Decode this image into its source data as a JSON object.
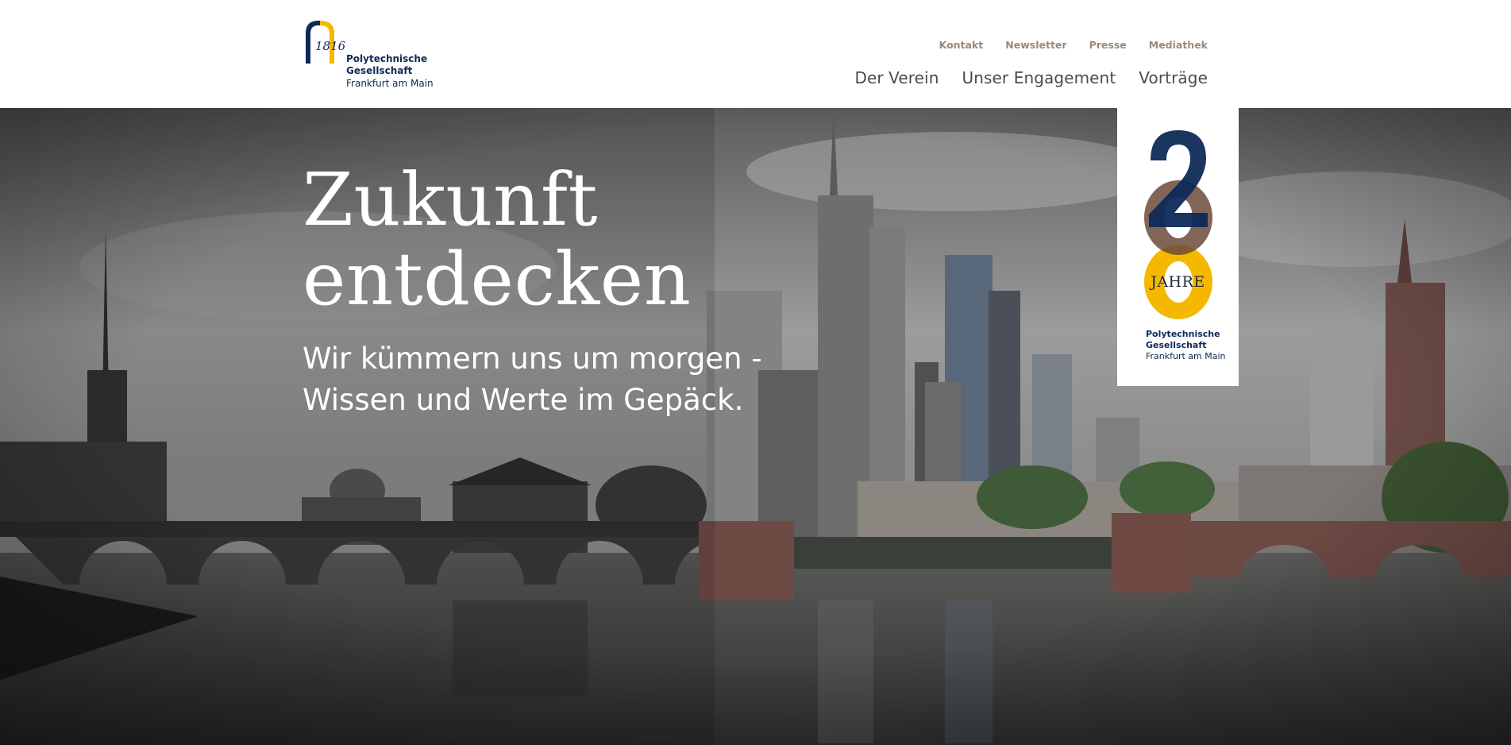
{
  "logo": {
    "year": "1816",
    "line1": "Polytechnische",
    "line2": "Gesellschaft",
    "line3": "Frankfurt am Main",
    "colors": {
      "navy": "#0d2a57",
      "gold": "#f5b800"
    }
  },
  "meta_nav": {
    "items": [
      {
        "label": "Kontakt"
      },
      {
        "label": "Newsletter"
      },
      {
        "label": "Presse"
      },
      {
        "label": "Mediathek"
      }
    ]
  },
  "main_nav": {
    "items": [
      {
        "label": "Der Verein"
      },
      {
        "label": "Unser Engagement"
      },
      {
        "label": "Vorträge"
      }
    ]
  },
  "hero": {
    "title_line1": "Zukunft",
    "title_line2": "entdecken",
    "subtitle_line1": "Wir kümmern uns um morgen -",
    "subtitle_line2": "Wissen und Werte im Gepäck.",
    "image": "frankfurt-skyline-bridge-photo"
  },
  "badge": {
    "number": "200",
    "label": "JAHRE",
    "line1": "Polytechnische",
    "line2": "Gesellschaft",
    "line3": "Frankfurt am Main",
    "colors": {
      "navy": "#0d2a57",
      "brown": "#6b4a3a",
      "gold": "#f5b800"
    }
  }
}
